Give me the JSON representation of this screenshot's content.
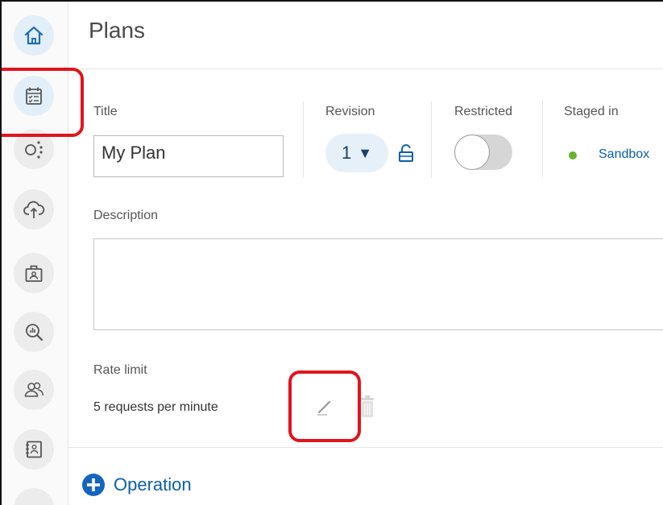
{
  "sidebar": {
    "items": [
      {
        "icon": "home-icon",
        "active": true
      },
      {
        "icon": "plan-calendar-icon",
        "active": true
      },
      {
        "icon": "nodes-icon",
        "active": false
      },
      {
        "icon": "cloud-upload-icon",
        "active": false
      },
      {
        "icon": "badge-case-icon",
        "active": false
      },
      {
        "icon": "analytics-search-icon",
        "active": false
      },
      {
        "icon": "users-icon",
        "active": false
      },
      {
        "icon": "contacts-book-icon",
        "active": false
      }
    ]
  },
  "header": {
    "title": "Plans"
  },
  "form": {
    "title_label": "Title",
    "title_value": "My Plan",
    "revision_label": "Revision",
    "revision_value": "1",
    "revision_arrow": "▼",
    "restricted_label": "Restricted",
    "restricted_on": false,
    "staged_label": "Staged in",
    "staged_value": "Sandbox",
    "staged_status_color": "#64b42d",
    "description_label": "Description",
    "description_value": "",
    "rate_limit_label": "Rate limit",
    "rate_limit_value": "5 requests per minute"
  },
  "footer": {
    "operation_label": "Operation"
  },
  "colors": {
    "accent": "#0b5fa5",
    "highlight": "#e0141e",
    "revision_bg": "#e6f0f8"
  }
}
